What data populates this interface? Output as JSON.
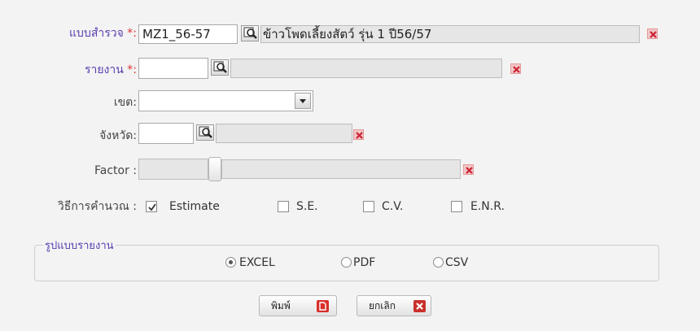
{
  "form": {
    "survey": {
      "label": "แบบสำรวจ",
      "required_mark": "*:",
      "code": "MZ1_56-57",
      "description": "ข้าวโพดเลี้ยงสัตว์ รุ่น 1 ปี56/57"
    },
    "report": {
      "label": "รายงาน",
      "required_mark": "*:",
      "code": "",
      "description": ""
    },
    "zone": {
      "label": "เขต:",
      "value": ""
    },
    "province": {
      "label": "จังหวัด:",
      "code": "",
      "description": ""
    },
    "factor": {
      "label": "Factor :",
      "value": ""
    },
    "method": {
      "label": "วิธีการคำนวณ :",
      "options": [
        {
          "label": "Estimate",
          "checked": true
        },
        {
          "label": "S.E.",
          "checked": false
        },
        {
          "label": "C.V.",
          "checked": false
        },
        {
          "label": "E.N.R.",
          "checked": false
        }
      ]
    },
    "format": {
      "legend": "รูปแบบรายงาน",
      "options": [
        {
          "label": "EXCEL",
          "selected": true
        },
        {
          "label": "PDF",
          "selected": false
        },
        {
          "label": "CSV",
          "selected": false
        }
      ]
    }
  },
  "buttons": {
    "print": "พิมพ์",
    "cancel": "ยกเลิก"
  },
  "colors": {
    "required_label": "#5a3db0",
    "required_star": "#dd3333",
    "print_icon": "#d9302c",
    "cancel_icon": "#c9302c"
  }
}
